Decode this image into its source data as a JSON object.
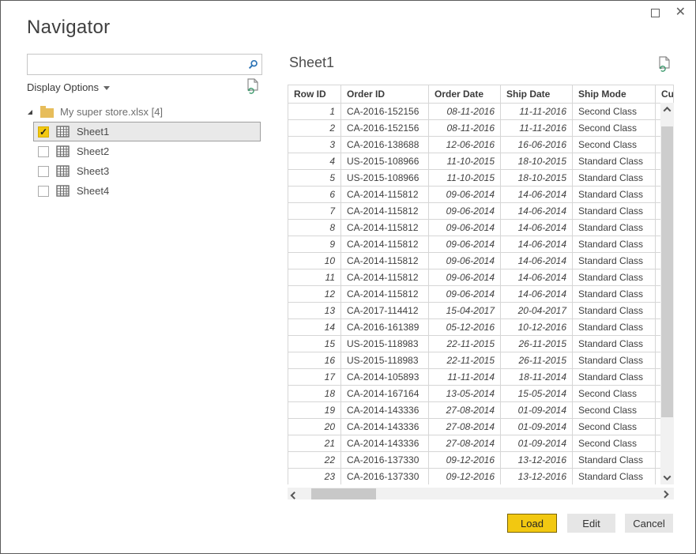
{
  "window": {
    "title": "Navigator",
    "controls": {
      "maximize": "maximize",
      "close": "✕"
    }
  },
  "sidebar": {
    "search": {
      "value": "",
      "placeholder": ""
    },
    "display_options_label": "Display Options",
    "tree": {
      "root_label": "My super store.xlsx [4]",
      "items": [
        {
          "label": "Sheet1",
          "checked": true,
          "selected": true
        },
        {
          "label": "Sheet2",
          "checked": false,
          "selected": false
        },
        {
          "label": "Sheet3",
          "checked": false,
          "selected": false
        },
        {
          "label": "Sheet4",
          "checked": false,
          "selected": false
        }
      ]
    }
  },
  "preview": {
    "title": "Sheet1",
    "table": {
      "columns": [
        "Row ID",
        "Order ID",
        "Order Date",
        "Ship Date",
        "Ship Mode",
        "Cus"
      ],
      "rows": [
        [
          "1",
          "CA-2016-152156",
          "08-11-2016",
          "11-11-2016",
          "Second Class"
        ],
        [
          "2",
          "CA-2016-152156",
          "08-11-2016",
          "11-11-2016",
          "Second Class"
        ],
        [
          "3",
          "CA-2016-138688",
          "12-06-2016",
          "16-06-2016",
          "Second Class"
        ],
        [
          "4",
          "US-2015-108966",
          "11-10-2015",
          "18-10-2015",
          "Standard Class"
        ],
        [
          "5",
          "US-2015-108966",
          "11-10-2015",
          "18-10-2015",
          "Standard Class"
        ],
        [
          "6",
          "CA-2014-115812",
          "09-06-2014",
          "14-06-2014",
          "Standard Class"
        ],
        [
          "7",
          "CA-2014-115812",
          "09-06-2014",
          "14-06-2014",
          "Standard Class"
        ],
        [
          "8",
          "CA-2014-115812",
          "09-06-2014",
          "14-06-2014",
          "Standard Class"
        ],
        [
          "9",
          "CA-2014-115812",
          "09-06-2014",
          "14-06-2014",
          "Standard Class"
        ],
        [
          "10",
          "CA-2014-115812",
          "09-06-2014",
          "14-06-2014",
          "Standard Class"
        ],
        [
          "11",
          "CA-2014-115812",
          "09-06-2014",
          "14-06-2014",
          "Standard Class"
        ],
        [
          "12",
          "CA-2014-115812",
          "09-06-2014",
          "14-06-2014",
          "Standard Class"
        ],
        [
          "13",
          "CA-2017-114412",
          "15-04-2017",
          "20-04-2017",
          "Standard Class"
        ],
        [
          "14",
          "CA-2016-161389",
          "05-12-2016",
          "10-12-2016",
          "Standard Class"
        ],
        [
          "15",
          "US-2015-118983",
          "22-11-2015",
          "26-11-2015",
          "Standard Class"
        ],
        [
          "16",
          "US-2015-118983",
          "22-11-2015",
          "26-11-2015",
          "Standard Class"
        ],
        [
          "17",
          "CA-2014-105893",
          "11-11-2014",
          "18-11-2014",
          "Standard Class"
        ],
        [
          "18",
          "CA-2014-167164",
          "13-05-2014",
          "15-05-2014",
          "Second Class"
        ],
        [
          "19",
          "CA-2014-143336",
          "27-08-2014",
          "01-09-2014",
          "Second Class"
        ],
        [
          "20",
          "CA-2014-143336",
          "27-08-2014",
          "01-09-2014",
          "Second Class"
        ],
        [
          "21",
          "CA-2014-143336",
          "27-08-2014",
          "01-09-2014",
          "Second Class"
        ],
        [
          "22",
          "CA-2016-137330",
          "09-12-2016",
          "13-12-2016",
          "Standard Class"
        ],
        [
          "23",
          "CA-2016-137330",
          "09-12-2016",
          "13-12-2016",
          "Standard Class"
        ]
      ]
    }
  },
  "footer": {
    "load_label": "Load",
    "edit_label": "Edit",
    "cancel_label": "Cancel"
  },
  "colors": {
    "accent": "#f2c811",
    "search_icon": "#2e75b6",
    "refresh_green": "#3e9b6e",
    "border_dark": "#5b5b5b",
    "grid_line": "#d6d6d6"
  }
}
